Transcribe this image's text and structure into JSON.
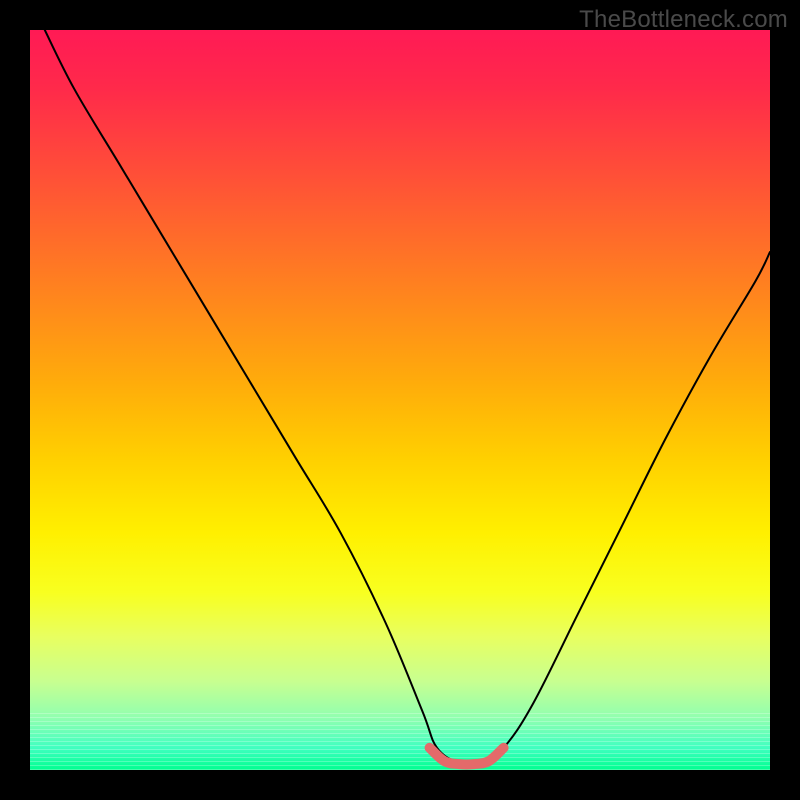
{
  "watermark": "TheBottleneck.com",
  "chart_data": {
    "type": "line",
    "title": "",
    "xlabel": "",
    "ylabel": "",
    "xlim": [
      0,
      100
    ],
    "ylim": [
      0,
      100
    ],
    "series": [
      {
        "name": "bottleneck-curve",
        "x": [
          2,
          6,
          12,
          18,
          24,
          30,
          36,
          42,
          48,
          53,
          55,
          58,
          61,
          64,
          68,
          74,
          80,
          86,
          92,
          98,
          100
        ],
        "y": [
          100,
          92,
          82,
          72,
          62,
          52,
          42,
          32,
          20,
          8,
          3,
          1,
          1,
          3,
          9,
          21,
          33,
          45,
          56,
          66,
          70
        ]
      },
      {
        "name": "flat-bottom-marker",
        "x": [
          54,
          56,
          58,
          60,
          62,
          64
        ],
        "y": [
          3,
          1.2,
          0.8,
          0.8,
          1.2,
          3
        ]
      }
    ],
    "colors": {
      "curve": "#000000",
      "marker": "#e46a6a",
      "gradient_top": "#ff1a55",
      "gradient_mid": "#ffd000",
      "gradient_bottom": "#00ff90"
    }
  }
}
